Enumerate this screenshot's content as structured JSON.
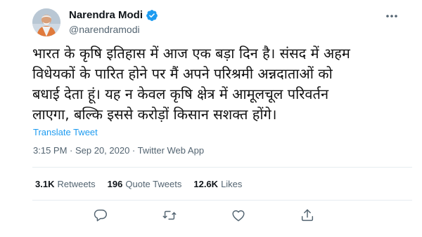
{
  "author": {
    "name": "Narendra Modi",
    "handle": "@narendramodi",
    "verified": true
  },
  "tweet": {
    "text": "भारत के कृषि इतिहास में आज एक बड़ा दिन है। संसद में अहम\nविधेयकों के पारित होने पर मैं अपने परिश्रमी अन्नदाताओं को\nबधाई देता हूं। यह न केवल कृषि क्षेत्र में आमूलचूल परिवर्तन\nलाएगा, बल्कि इससे करोड़ों किसान सशक्त होंगे।",
    "translate_label": "Translate Tweet",
    "meta": "3:15 PM · Sep 20, 2020 · Twitter Web App"
  },
  "stats": {
    "retweets": {
      "count": "3.1K",
      "label": "Retweets"
    },
    "quote_tweets": {
      "count": "196",
      "label": "Quote Tweets"
    },
    "likes": {
      "count": "12.6K",
      "label": "Likes"
    }
  },
  "actions": [
    "reply-icon",
    "retweet-icon",
    "like-icon",
    "share-icon"
  ],
  "colors": {
    "link": "#1d9bf0",
    "secondary_text": "#536471",
    "icon": "#536471",
    "divider": "#e6ecf0"
  }
}
